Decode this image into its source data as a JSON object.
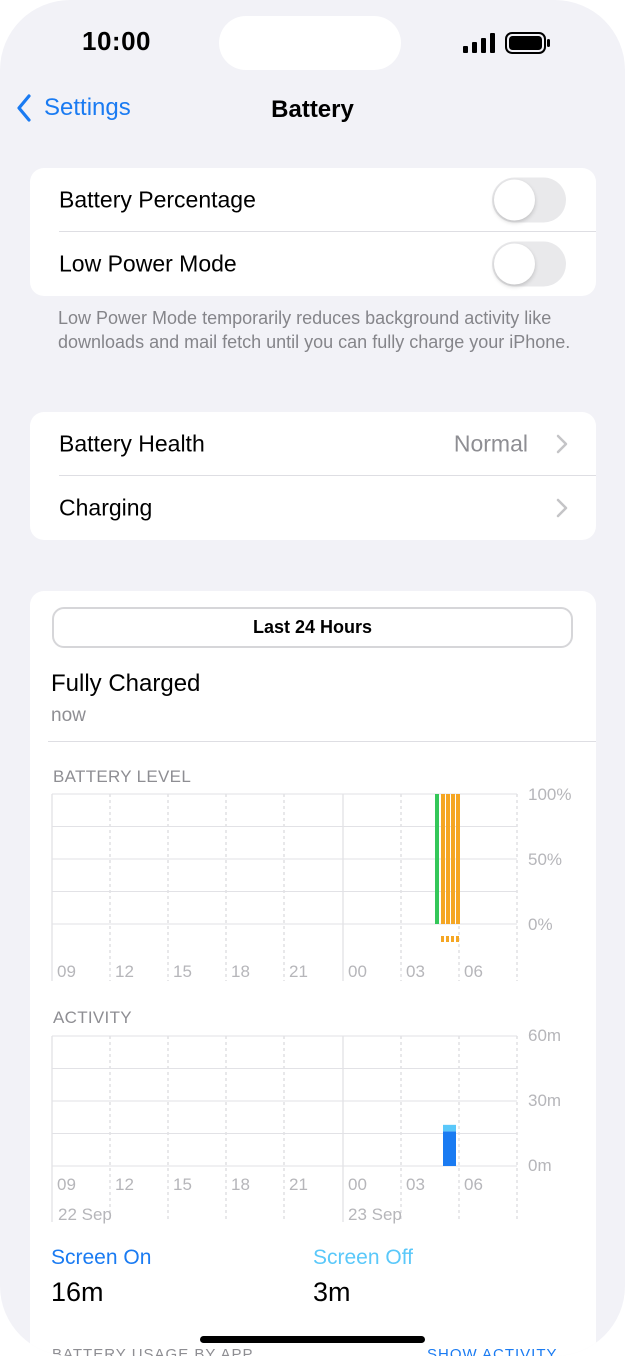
{
  "status_bar": {
    "time": "10:00"
  },
  "nav": {
    "back_label": "Settings",
    "title": "Battery"
  },
  "toggles": [
    {
      "label": "Battery Percentage",
      "on": false
    },
    {
      "label": "Low Power Mode",
      "on": false
    }
  ],
  "low_power_note": "Low Power Mode temporarily reduces background activity like downloads and mail fetch until you can fully charge your iPhone.",
  "health": {
    "label": "Battery Health",
    "value": "Normal"
  },
  "charging": {
    "label": "Charging"
  },
  "segment": {
    "selected": "Last 24 Hours"
  },
  "charge_status": {
    "title": "Fully Charged",
    "subtitle": "now"
  },
  "colors": {
    "accent": "#1a7bf2",
    "screen_on": "#1a7bf2",
    "screen_off": "#5ac8fa",
    "charging_bar": "#f5a623",
    "level_bar": "#34c759"
  },
  "chart_data": [
    {
      "type": "bar",
      "title": "BATTERY LEVEL",
      "x_ticks": [
        "09",
        "12",
        "15",
        "18",
        "21",
        "00",
        "03",
        "06"
      ],
      "y_ticks": [
        "100%",
        "50%",
        "0%"
      ],
      "ylim": [
        0,
        100
      ],
      "series": [
        {
          "values": [
            100
          ]
        }
      ],
      "charging_intervals": 4
    },
    {
      "type": "bar",
      "title": "ACTIVITY",
      "x_ticks": [
        "09",
        "12",
        "15",
        "18",
        "21",
        "00",
        "03",
        "06"
      ],
      "date_labels": [
        "22 Sep",
        "23 Sep"
      ],
      "y_ticks": [
        "60m",
        "30m",
        "0m"
      ],
      "ylim": [
        0,
        60
      ],
      "series": [
        {
          "name": "Screen On",
          "values": [
            16
          ]
        },
        {
          "name": "Screen Off",
          "values": [
            3
          ]
        }
      ]
    }
  ],
  "usage": {
    "screen_on": {
      "label": "Screen On",
      "value": "16m"
    },
    "screen_off": {
      "label": "Screen Off",
      "value": "3m"
    }
  },
  "bottom_section": {
    "left": "BATTERY USAGE BY APP",
    "right": "SHOW ACTIVITY"
  }
}
